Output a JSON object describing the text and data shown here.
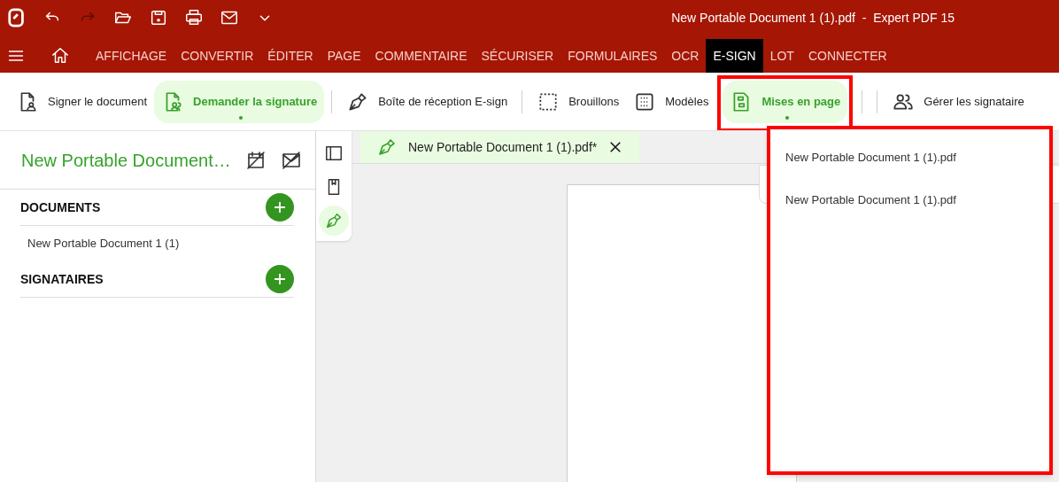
{
  "window": {
    "title": "New Portable Document 1 (1).pdf  -  Expert PDF 15"
  },
  "menu_tabs": [
    {
      "label": "AFFICHAGE",
      "selected": false
    },
    {
      "label": "CONVERTIR",
      "selected": false
    },
    {
      "label": "ÉDITER",
      "selected": false
    },
    {
      "label": "PAGE",
      "selected": false
    },
    {
      "label": "COMMENTAIRE",
      "selected": false
    },
    {
      "label": "SÉCURISER",
      "selected": false
    },
    {
      "label": "FORMULAIRES",
      "selected": false
    },
    {
      "label": "OCR",
      "selected": false
    },
    {
      "label": "E-SIGN",
      "selected": true
    },
    {
      "label": "LOT",
      "selected": false
    },
    {
      "label": "CONNECTER",
      "selected": false
    }
  ],
  "toolbar": [
    {
      "label": "Signer le document",
      "kind": "sign",
      "selected": false,
      "highlighted": false
    },
    {
      "label": "Demander la signature",
      "kind": "request",
      "selected": true,
      "highlighted": false
    },
    {
      "label": "Boîte de réception E-sign",
      "kind": "inbox",
      "selected": false,
      "highlighted": false
    },
    {
      "label": "Brouillons",
      "kind": "drafts",
      "selected": false,
      "highlighted": false
    },
    {
      "label": "Modèles",
      "kind": "templates",
      "selected": false,
      "highlighted": false
    },
    {
      "label": "Mises en page",
      "kind": "layouts",
      "selected": true,
      "highlighted": true
    },
    {
      "label": "Gérer les signataire",
      "kind": "signers",
      "selected": false,
      "highlighted": false
    }
  ],
  "panel": {
    "title": "New Portable Document…",
    "sections": [
      {
        "heading": "DOCUMENTS",
        "items": [
          "New Portable Document 1 (1)"
        ]
      },
      {
        "heading": "SIGNATAIRES"
      }
    ]
  },
  "side_strip": [
    {
      "kind": "sidebar",
      "selected": false
    },
    {
      "kind": "bookmark",
      "selected": false
    },
    {
      "kind": "pen",
      "selected": true
    }
  ],
  "document_tab": {
    "label": "New Portable Document 1 (1).pdf*"
  },
  "dropdown": {
    "highlighted": true,
    "items": [
      "New Portable Document 1 (1).pdf",
      "New Portable Document 1 (1).pdf"
    ]
  }
}
